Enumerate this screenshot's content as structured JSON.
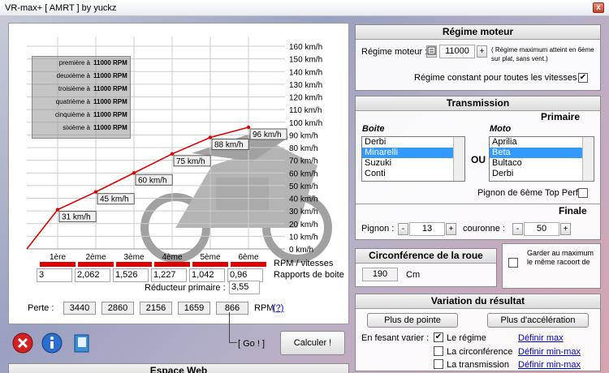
{
  "window": {
    "title": "VR-max+ [ AMRT ] by yuckz",
    "close": "x"
  },
  "gears": {
    "rows": [
      {
        "name": "première à",
        "rpm": "11000 RPM"
      },
      {
        "name": "deuxième à",
        "rpm": "11000 RPM"
      },
      {
        "name": "troisième à",
        "rpm": "11000 RPM"
      },
      {
        "name": "quatrième à",
        "rpm": "11000 RPM"
      },
      {
        "name": "cinquième à",
        "rpm": "11000 RPM"
      },
      {
        "name": "sixième à",
        "rpm": "11000 RPM"
      }
    ]
  },
  "chart_data": {
    "type": "line",
    "categories": [
      "1ère",
      "2ème",
      "3ème",
      "4ème",
      "5ème",
      "6ème"
    ],
    "series": [
      {
        "values": [
          31,
          45,
          60,
          75,
          88,
          96
        ]
      }
    ],
    "point_labels": [
      "31 km/h",
      "45 km/h",
      "60 km/h",
      "75 km/h",
      "88 km/h",
      "96 km/h"
    ],
    "ylim": [
      0,
      160
    ],
    "yticks": [
      "0 km/h",
      "10 km/h",
      "20 km/h",
      "30 km/h",
      "40 km/h",
      "50 km/h",
      "60 km/h",
      "70 km/h",
      "80 km/h",
      "90 km/h",
      "100 km/h",
      "110 km/h",
      "120 km/h",
      "130 km/h",
      "140 km/h",
      "150 km/h",
      "160 km/h"
    ],
    "xlabel": "RPM / vitesses",
    "color": "#e00000"
  },
  "ratios": {
    "values": [
      "3",
      "2,062",
      "1,526",
      "1,227",
      "1,042",
      "0,96"
    ],
    "label": "Rapports de boite",
    "primary_label": "Réducteur primaire :",
    "primary_value": "3,55"
  },
  "perte": {
    "label": "Perte :",
    "values": [
      "3440",
      "2860",
      "2156",
      "1659",
      "866"
    ],
    "unit": "RPM",
    "help": "(?)"
  },
  "actions": {
    "go_label": "[ Go ! ]",
    "calc_label": "Calculer !"
  },
  "espace_web": "Espace Web",
  "regime": {
    "title": "Régime moteur",
    "label": "Régime moteur :",
    "value": "11000",
    "plus": "+",
    "note": "( Régime maximum atteint en 6ème sur plat, sans vent.)",
    "constant_label": "Régime constant pour toutes les vitesses",
    "constant_checked": "✔"
  },
  "transmission": {
    "title": "Transmission",
    "primaire": "Primaire",
    "boite_label": "Boite",
    "boite_items": [
      "Derbi",
      "Minarelli",
      "Suzuki",
      "Conti"
    ],
    "ou": "OU",
    "moto_label": "Moto",
    "moto_items": [
      "Aprilia",
      "Beta",
      "Bultaco",
      "Derbi"
    ],
    "pignon_top_label": "Pignon de 6ème Top Perf",
    "finale": "Finale",
    "pignon_label": "Pignon :",
    "pignon_value": "13",
    "couronne_label": "couronne :",
    "couronne_value": "50",
    "minus": "-",
    "plus": "+"
  },
  "circonference": {
    "title": "Circonférence de la roue",
    "value": "190",
    "unit": "Cm",
    "garder_label": "Garder au maximum le même racoort de"
  },
  "variation": {
    "title": "Variation du résultat",
    "pointe_label": "Plus de pointe",
    "acceleration_label": "Plus d'accélération",
    "varier_label": "En fesant varier :",
    "options": [
      {
        "label": "Le régime",
        "check": "✔",
        "link": "Définir max"
      },
      {
        "label": "La circonférence",
        "check": "",
        "link": "Définir min-max"
      },
      {
        "label": "La transmission",
        "check": "",
        "link": "Définir min-max"
      }
    ]
  }
}
